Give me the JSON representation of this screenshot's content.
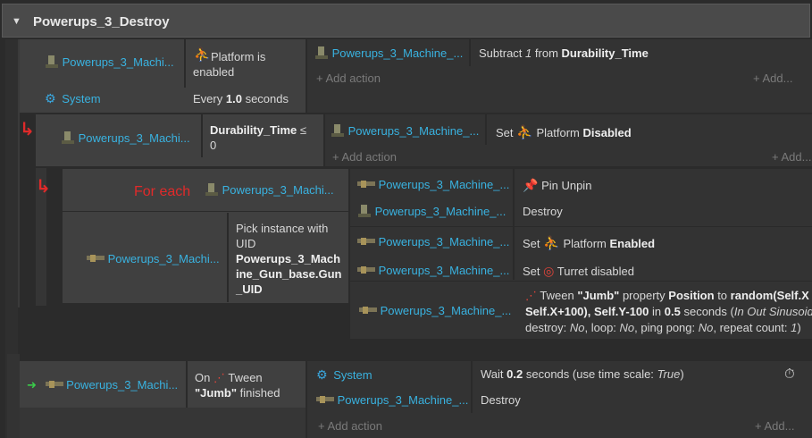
{
  "group": {
    "title": "Powerups_3_Destroy"
  },
  "event1": {
    "c1_object": "Powerups_3_Machi...",
    "c1_text": "Platform is enabled",
    "c2_object": "System",
    "c2_text_pre": "Every",
    "c2_value": "1.0",
    "c2_text_post": "seconds",
    "a1_object": "Powerups_3_Machine_...",
    "a1_pre": "Subtract",
    "a1_value": "1",
    "a1_mid": "from",
    "a1_var": "Durability_Time",
    "add_action": "Add action",
    "add_more": "Add..."
  },
  "event2": {
    "c1_object": "Powerups_3_Machi...",
    "c1_var": "Durability_Time",
    "c1_op": "≤",
    "c1_value": "0",
    "a1_object": "Powerups_3_Machine_...",
    "a1_pre": "Set",
    "a1_beh": "Platform",
    "a1_state": "Disabled",
    "add_action": "Add action",
    "add_more": "Add..."
  },
  "event3": {
    "foreach_label": "For each",
    "foreach_object": "Powerups_3_Machi...",
    "c2_object": "Powerups_3_Machi...",
    "c2_text": "Pick instance with UID",
    "c2_expr": "Powerups_3_Machine_Gun_base.Gun_UID",
    "a1_object": "Powerups_3_Machine_...",
    "a1_text": "Pin Unpin",
    "a2_object": "Powerups_3_Machine_...",
    "a2_text": "Destroy",
    "a3_object": "Powerups_3_Machine_...",
    "a3_pre": "Set",
    "a3_beh": "Platform",
    "a3_state": "Enabled",
    "a4_object": "Powerups_3_Machine_...",
    "a4_pre": "Set",
    "a4_text": "Turret disabled",
    "a5_object": "Powerups_3_Machine_...",
    "a5_tween": "Tween",
    "a5_name": "\"Jumb\"",
    "a5_prop": "property",
    "a5_pos": "Position",
    "a5_to": "to",
    "a5_expr1": "random(Self.X",
    "a5_expr2": "Self.X+100), Self.Y-100",
    "a5_in": "in",
    "a5_dur": "0.5",
    "a5_sec": "seconds (",
    "a5_ease": "In Out Sinusoid",
    "a5_line3_pre": "destroy:",
    "a5_destroy": "No",
    "a5_loop_lbl": ", loop:",
    "a5_loop": "No",
    "a5_ping_lbl": ", ping pong:",
    "a5_ping": "No",
    "a5_rep_lbl": ", repeat count:",
    "a5_rep": "1",
    "a5_close": ")"
  },
  "event4": {
    "c1_object": "Powerups_3_Machi...",
    "c1_on": "On",
    "c1_tween": "Tween",
    "c1_name": "\"Jumb\"",
    "c1_finished": "finished",
    "a1_object": "System",
    "a1_pre": "Wait",
    "a1_value": "0.2",
    "a1_post": "seconds (use time scale:",
    "a1_scale": "True",
    "a1_close": ")",
    "a2_object": "Powerups_3_Machine_...",
    "a2_text": "Destroy",
    "add_action": "Add action",
    "add_more": "Add..."
  },
  "icons": {
    "gear": "⚙",
    "run": "🏃",
    "pin": "📌",
    "turret": "◎",
    "tween": "⋰",
    "timer": "⏱",
    "plus": "+",
    "green_arrow": "➜"
  },
  "colors": {
    "object_link": "#39b2e0",
    "accent_red": "#e02a2a",
    "background": "#2b2b2b"
  }
}
